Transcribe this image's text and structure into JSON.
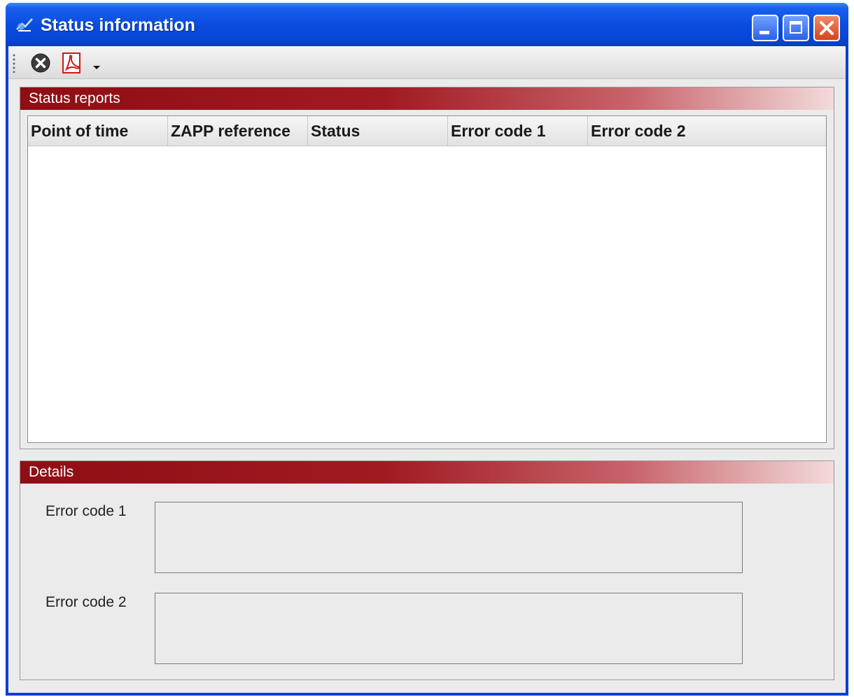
{
  "window": {
    "title": "Status information",
    "icons": {
      "app": "app-icon",
      "minimize": "minimize-icon",
      "maximize": "maximize-icon",
      "close": "close-icon"
    }
  },
  "toolbar": {
    "items": [
      {
        "name": "cancel-button",
        "icon": "cancel-circle-icon"
      },
      {
        "name": "pdf-export-button",
        "icon": "pdf-icon"
      },
      {
        "name": "dropdown-arrow",
        "icon": "chevron-down-icon"
      }
    ]
  },
  "status_reports": {
    "title": "Status reports",
    "columns": [
      "Point of time",
      "ZAPP reference",
      "Status",
      "Error code 1",
      "Error code 2"
    ],
    "rows": []
  },
  "details": {
    "title": "Details",
    "error_code_1_label": "Error code 1",
    "error_code_1_value": "",
    "error_code_2_label": "Error code 2",
    "error_code_2_value": ""
  },
  "colors": {
    "titlebar": "#0845d4",
    "panel_header": "#8f0d14",
    "client_bg": "#ebebeb"
  }
}
